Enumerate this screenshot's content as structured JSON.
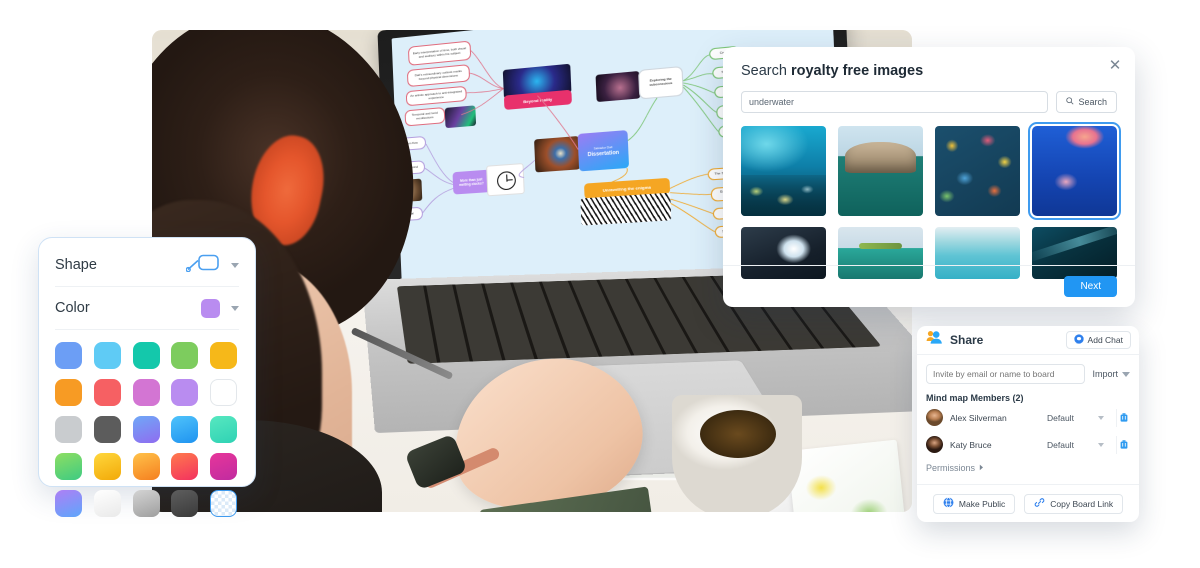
{
  "shape_panel": {
    "shape_label": "Shape",
    "color_label": "Color",
    "shape_icon": "rounded-rect-shape-icon",
    "current_color": "#b98cf0",
    "swatches": [
      {
        "name": "cornflower-blue",
        "hex": "#6c9ef5"
      },
      {
        "name": "sky-blue",
        "hex": "#5fcbf5"
      },
      {
        "name": "teal",
        "hex": "#14c8ab"
      },
      {
        "name": "light-green",
        "hex": "#7dcc5e"
      },
      {
        "name": "amber",
        "hex": "#f6b819"
      },
      {
        "name": "orange",
        "hex": "#f79b24"
      },
      {
        "name": "coral-red",
        "hex": "#f66063"
      },
      {
        "name": "orchid",
        "hex": "#d375d3"
      },
      {
        "name": "light-purple",
        "hex": "#b98cf0"
      },
      {
        "name": "white",
        "hex": "#ffffff"
      },
      {
        "name": "light-gray",
        "hex": "#c9cccf"
      },
      {
        "name": "dark-gray",
        "hex": "#5c5c5c"
      },
      {
        "name": "violet-blue-gradient",
        "hex": "#7e6cf2"
      },
      {
        "name": "bright-blue",
        "hex": "#2aa8f7"
      },
      {
        "name": "mint-gradient",
        "hex": "#3ce0bd"
      },
      {
        "name": "green-gradient",
        "hex": "#4fd17a"
      },
      {
        "name": "gold-gradient",
        "hex": "#f9c219"
      },
      {
        "name": "orange-gradient",
        "hex": "#f99331"
      },
      {
        "name": "red-pink-gradient",
        "hex": "#f6504f"
      },
      {
        "name": "magenta-gradient",
        "hex": "#d9389b"
      },
      {
        "name": "purple-blue-gradient",
        "hex": "#9a7df4"
      },
      {
        "name": "near-white-gradient",
        "hex": "#f4f4f4"
      },
      {
        "name": "silver-gradient",
        "hex": "#b5b5b5"
      },
      {
        "name": "charcoal-gradient",
        "hex": "#474747"
      },
      {
        "name": "transparent",
        "hex": "transparent"
      }
    ]
  },
  "search_dialog": {
    "title_prefix": "Search ",
    "title_bold": "royalty free images",
    "close_icon": "close-icon",
    "query_value": "underwater",
    "query_placeholder": "underwater",
    "search_button_label": "Search",
    "search_icon": "search-icon",
    "next_button_label": "Next",
    "results": [
      {
        "name": "coral-reef-sunlight",
        "selected": false
      },
      {
        "name": "rock-arch-half-underwater",
        "selected": false
      },
      {
        "name": "colorful-coral-garden",
        "selected": false
      },
      {
        "name": "jellyfish-blue-water",
        "selected": true
      },
      {
        "name": "dark-water-sunburst",
        "selected": false
      },
      {
        "name": "island-split-waterline",
        "selected": false
      },
      {
        "name": "turquoise-shallow-water",
        "selected": false
      },
      {
        "name": "deep-dark-blue-water",
        "selected": false
      }
    ]
  },
  "share_panel": {
    "title": "Share",
    "share_icon": "people-icon",
    "add_chat_label": "Add Chat",
    "add_chat_icon": "chat-bubble-icon",
    "invite_placeholder": "Invite by email or name to board",
    "import_label": "Import",
    "members_title": "Mind map Members (2)",
    "members": [
      {
        "name": "Alex Silverman",
        "role": "Default",
        "avatar": "avatar-alex",
        "delete_icon": "trash-icon"
      },
      {
        "name": "Katy Bruce",
        "role": "Default",
        "avatar": "avatar-katy",
        "delete_icon": "trash-icon"
      }
    ],
    "permissions_label": "Permissions",
    "permissions_icon": "chevron-right-icon",
    "make_public_label": "Make Public",
    "make_public_icon": "globe-icon",
    "copy_link_label": "Copy Board Link",
    "copy_link_icon": "link-icon"
  },
  "mindmap": {
    "center_node_sub": "Salvador Dalí",
    "center_node_title": "Dissertation",
    "branch_pink": "Beyond reality",
    "branch_white": "Exploring the subconscious",
    "branch_orange": "Unravelling the enigma",
    "branch_purple": "More than just melting clocks?",
    "nodes_red": [
      "Early interpretation of time, both visual and auditory within his subject",
      "Dalí's extraordinary outlook marks beyond physical dimensions",
      "An artistic approach to anti-integrated experience",
      "Temporal and lucid recollections"
    ],
    "nodes_purple": [
      "Dream flow",
      "Popular mind",
      "Emotional"
    ],
    "nodes_green": [
      "Crypt",
      "Surreal",
      "Psyche",
      "Inner inference",
      "Fantasy"
    ],
    "nodes_orange": [
      "The Surreal",
      "Enigmatic motifs",
      "Duality",
      "Symbolism"
    ]
  }
}
